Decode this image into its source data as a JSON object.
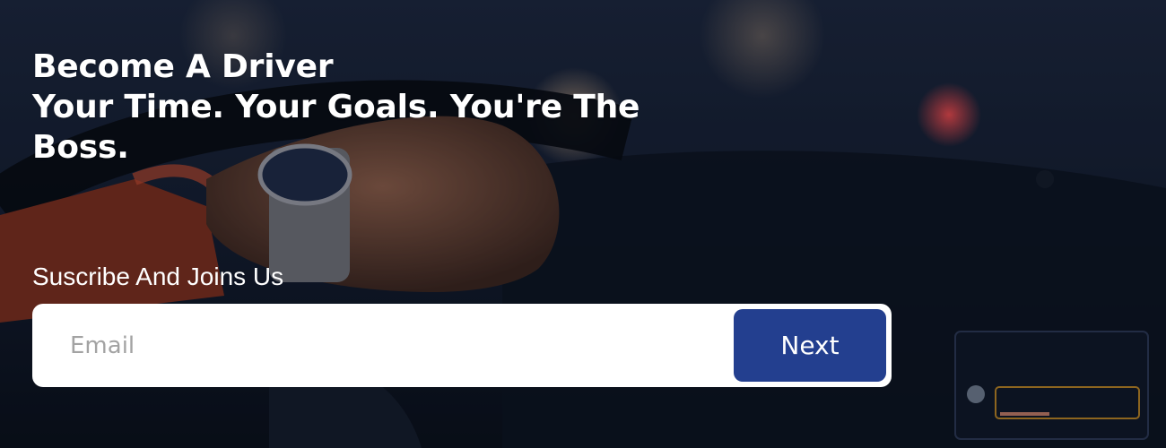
{
  "hero": {
    "title_line1": "Become A Driver",
    "title_line2": "Your Time. Your Goals. You're The Boss.",
    "subtitle": "Suscribe And Joins Us",
    "background_image": "car-dashboard-night-photo"
  },
  "form": {
    "email_placeholder": "Email",
    "email_value": "",
    "next_label": "Next",
    "next_color": "#233f8f"
  }
}
